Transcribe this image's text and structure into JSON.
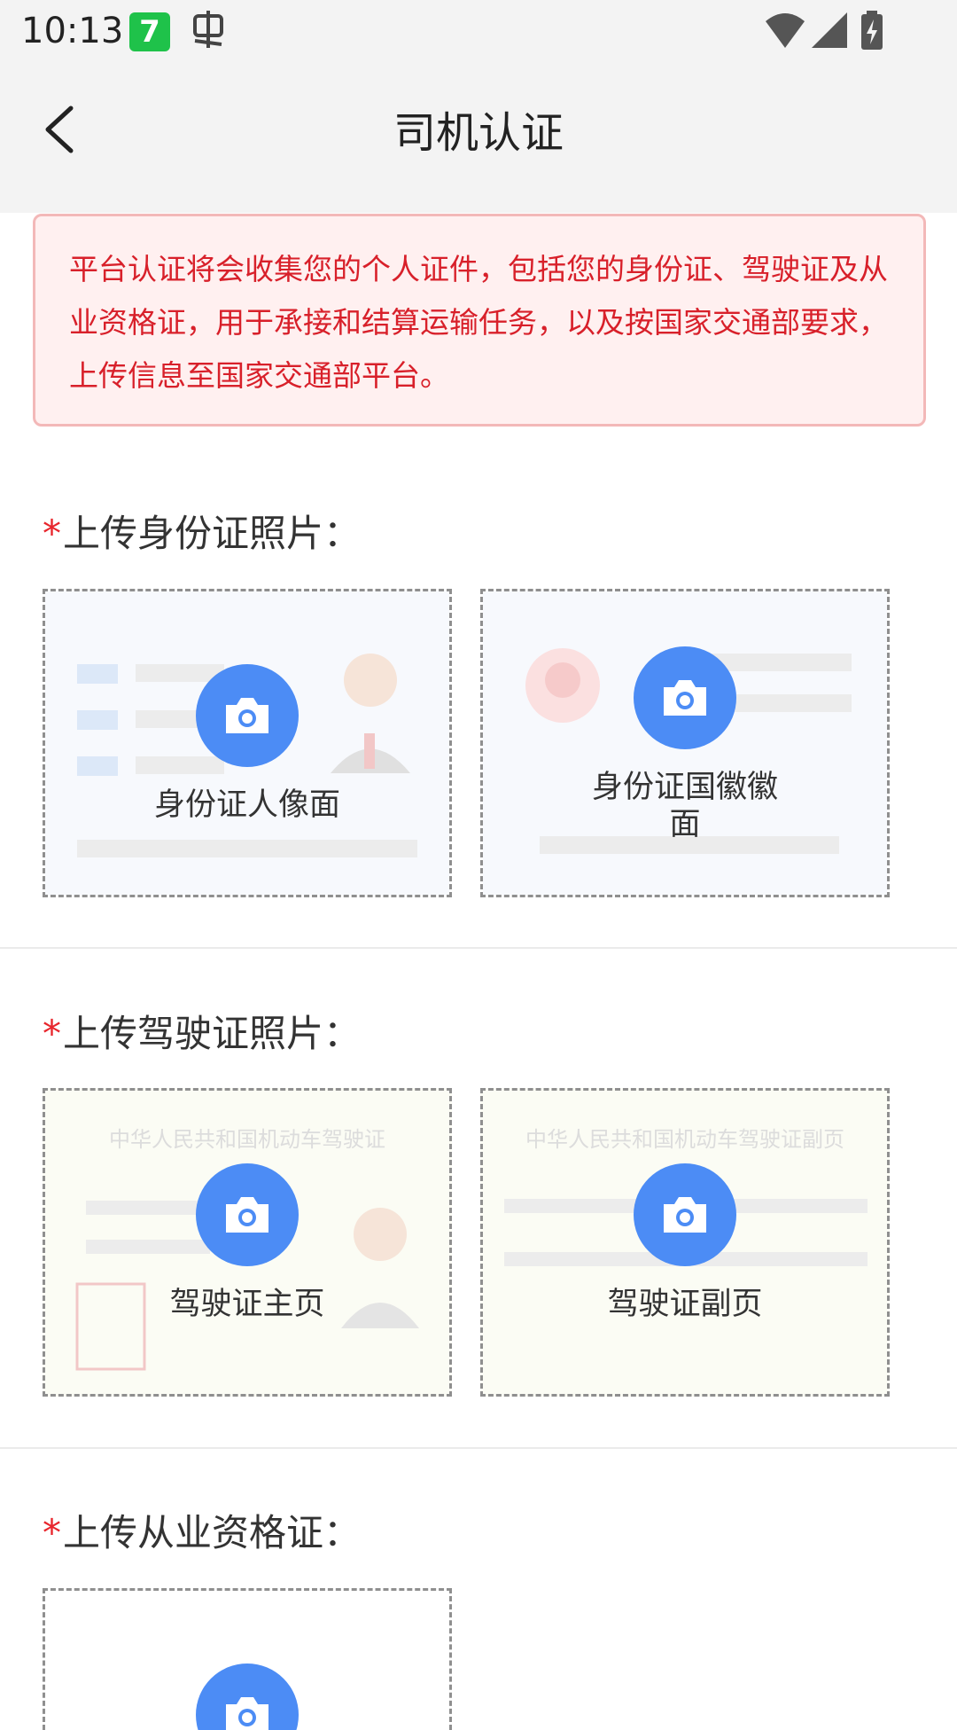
{
  "status_bar": {
    "time": "10:13",
    "app_icon_1": "7",
    "app_icon_2": "bug-icon"
  },
  "header": {
    "title": "司机认证",
    "back_icon": "chevron-left-icon"
  },
  "notice": {
    "text": "平台认证将会收集您的个人证件，包括您的身份证、驾驶证及从业资格证，用于承接和结算运输任务，以及按国家交通部要求，上传信息至国家交通部平台。"
  },
  "sections": [
    {
      "required_mark": "*",
      "title": "上传身份证照片：",
      "cards": [
        {
          "label": "身份证人像面",
          "icon": "camera-icon"
        },
        {
          "label": "身份证国徽徽面",
          "icon": "camera-icon"
        }
      ]
    },
    {
      "required_mark": "*",
      "title": "上传驾驶证照片：",
      "cards": [
        {
          "label": "驾驶证主页",
          "icon": "camera-icon",
          "watermark": "中华人民共和国机动车驾驶证"
        },
        {
          "label": "驾驶证副页",
          "icon": "camera-icon",
          "watermark": "中华人民共和国机动车驾驶证副页"
        }
      ]
    },
    {
      "required_mark": "*",
      "title": "上传从业资格证：",
      "cards": [
        {
          "label": "",
          "icon": "camera-icon"
        }
      ]
    }
  ],
  "colors": {
    "accent": "#4c8cf5",
    "notice_text": "#d8202a",
    "notice_bg": "#fff0f0",
    "required": "#e8262d"
  }
}
